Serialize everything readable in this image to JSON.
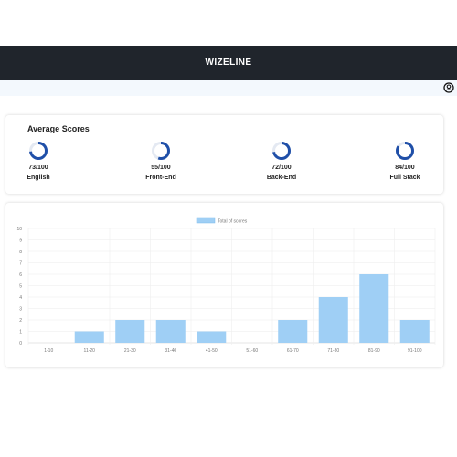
{
  "header": {
    "title": "WIZELINE"
  },
  "icons": {
    "user": "user-circle-icon"
  },
  "colors": {
    "header_bg": "#20252c",
    "ring": "#1f4fa8",
    "ring_track": "#e4e9f2",
    "bar": "#9fcff5"
  },
  "scores": {
    "title": "Average Scores",
    "items": [
      {
        "value": "73/100",
        "label": "English",
        "score": 73
      },
      {
        "value": "55/100",
        "label": "Front-End",
        "score": 55
      },
      {
        "value": "72/100",
        "label": "Back-End",
        "score": 72
      },
      {
        "value": "84/100",
        "label": "Full Stack",
        "score": 84
      }
    ]
  },
  "chart_data": {
    "type": "bar",
    "legend": "Total of scores",
    "legend_position": "top-center",
    "categories": [
      "1-10",
      "11-20",
      "21-30",
      "31-40",
      "41-50",
      "51-60",
      "61-70",
      "71-80",
      "81-90",
      "91-100"
    ],
    "values": [
      0,
      1,
      2,
      2,
      1,
      0,
      2,
      4,
      6,
      2
    ],
    "ylim": [
      0,
      10
    ],
    "yticks": [
      0,
      1,
      2,
      3,
      4,
      5,
      6,
      7,
      8,
      9,
      10
    ],
    "grid": true
  }
}
